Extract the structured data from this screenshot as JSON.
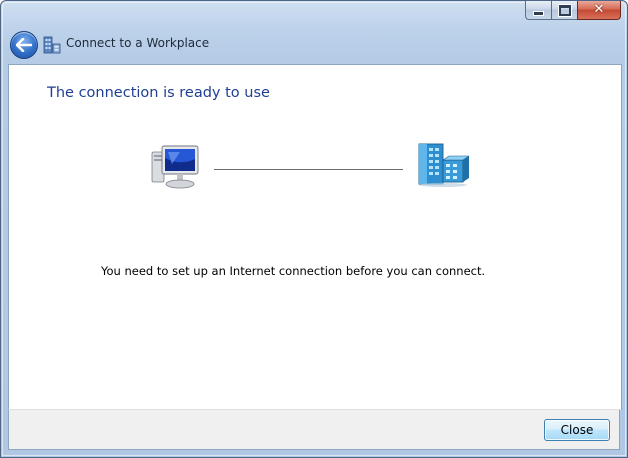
{
  "window": {
    "title": "Connect to a Workplace",
    "caption_buttons": {
      "minimize_icon": "minimize-icon",
      "maximize_icon": "maximize-icon",
      "close_glyph": "✕"
    }
  },
  "nav": {
    "back_icon": "back-arrow-icon",
    "app_icon": "workplace-connection-icon"
  },
  "content": {
    "heading": "The connection is ready to use",
    "left_icon": "computer-icon",
    "right_icon": "workplace-network-icon",
    "message": "You need to set up an Internet connection before you can connect."
  },
  "footer": {
    "close_label": "Close"
  },
  "colors": {
    "heading": "#1e3f93",
    "frame": "#b5cce6",
    "close_caption": "#c44a33"
  }
}
